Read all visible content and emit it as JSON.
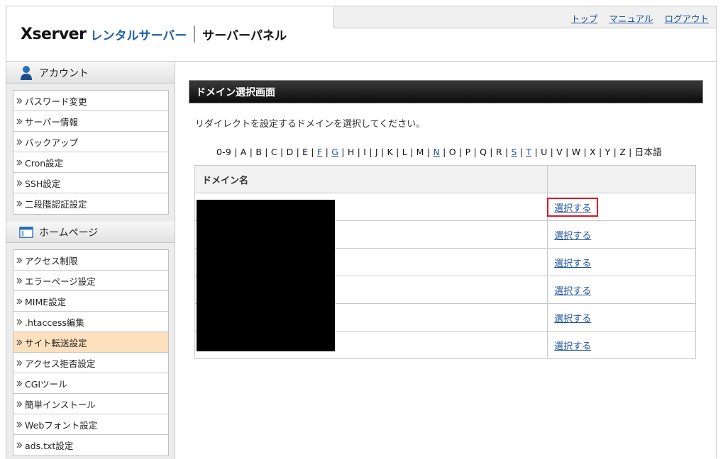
{
  "header": {
    "logo_brand": "Xserver",
    "logo_rental": "レンタルサーバー",
    "logo_panel": "サーバーパネル",
    "links": [
      "トップ",
      "マニュアル",
      "ログアウト"
    ]
  },
  "sidebar": {
    "account": {
      "title": "アカウント",
      "icon": "user-icon",
      "items": [
        "パスワード変更",
        "サーバー情報",
        "バックアップ",
        "Cron設定",
        "SSH設定",
        "二段階認証設定"
      ]
    },
    "homepage": {
      "title": "ホームページ",
      "icon": "window-icon",
      "items": [
        "アクセス制限",
        "エラーページ設定",
        "MIME設定",
        ".htaccess編集",
        "サイト転送設定",
        "アクセス拒否設定",
        "CGIツール",
        "簡単インストール",
        "Webフォント設定",
        "ads.txt設定"
      ],
      "active_item": "サイト転送設定"
    }
  },
  "main": {
    "title": "ドメイン選択画面",
    "description": "リダイレクトを設定するドメインを選択してください。",
    "alpha_index": [
      {
        "t": "0-9",
        "link": false
      },
      {
        "t": "A",
        "link": false
      },
      {
        "t": "B",
        "link": false
      },
      {
        "t": "C",
        "link": false
      },
      {
        "t": "D",
        "link": false
      },
      {
        "t": "E",
        "link": false
      },
      {
        "t": "F",
        "link": true
      },
      {
        "t": "G",
        "link": true
      },
      {
        "t": "H",
        "link": false
      },
      {
        "t": "I",
        "link": false
      },
      {
        "t": "J",
        "link": false
      },
      {
        "t": "K",
        "link": false
      },
      {
        "t": "L",
        "link": false
      },
      {
        "t": "M",
        "link": false
      },
      {
        "t": "N",
        "link": true
      },
      {
        "t": "O",
        "link": false
      },
      {
        "t": "P",
        "link": false
      },
      {
        "t": "Q",
        "link": false
      },
      {
        "t": "R",
        "link": false
      },
      {
        "t": "S",
        "link": true
      },
      {
        "t": "T",
        "link": true
      },
      {
        "t": "U",
        "link": false
      },
      {
        "t": "V",
        "link": false
      },
      {
        "t": "W",
        "link": false
      },
      {
        "t": "X",
        "link": false
      },
      {
        "t": "Y",
        "link": false
      },
      {
        "t": "Z",
        "link": false
      },
      {
        "t": "日本語",
        "link": false
      }
    ],
    "table": {
      "headers": [
        "ドメイン名",
        ""
      ],
      "select_label": "選択する",
      "row_count": 6
    }
  },
  "colors": {
    "link": "#1a4f9c",
    "active_bg": "#fde0bd",
    "highlight": "#e0141e",
    "titlebar": "#111111"
  }
}
